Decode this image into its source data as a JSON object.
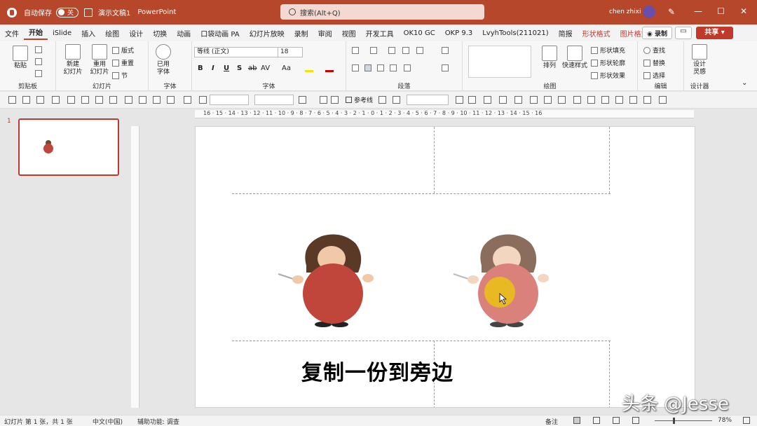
{
  "titlebar": {
    "autosave_label": "自动保存",
    "autosave_state": "关",
    "doc_title": "演示文稿1",
    "app_name": "PowerPoint",
    "search_placeholder": "搜索(Alt+Q)",
    "user_name": "chen zhixi",
    "minimize": "—",
    "restore": "☐",
    "close": "✕"
  },
  "tabs": [
    "文件",
    "开始",
    "iSlide",
    "插入",
    "绘图",
    "设计",
    "切换",
    "动画",
    "口袋动画 PA",
    "幻灯片放映",
    "录制",
    "审阅",
    "视图",
    "开发工具",
    "OK10 GC",
    "OKP 9.3",
    "LvyhTools(211021)",
    "简报",
    "形状格式",
    "图片格式"
  ],
  "active_tab": "开始",
  "actions": {
    "record": "◉ 录制",
    "comment": "▭",
    "share": "共享 ▾"
  },
  "ribbon": {
    "clipboard": {
      "paste": "粘贴",
      "label": "剪贴板"
    },
    "slides": {
      "new_slide": "新建\n幻灯片",
      "reuse": "重用\n幻灯片",
      "layout": "版式",
      "reset": "重置",
      "section": "节",
      "label": "幻灯片"
    },
    "font_ext": {
      "use_font": "已用字体",
      "label": "字体"
    },
    "font": {
      "name": "等线 (正文)",
      "size": "18",
      "bold": "B",
      "italic": "I",
      "underline": "U",
      "strike": "S",
      "shadow": "ab",
      "spacing": "AV",
      "case": "Aa",
      "label": "字体"
    },
    "paragraph": {
      "label": "段落"
    },
    "drawing": {
      "arrange": "排列",
      "quick_style": "快速样式",
      "fill": "形状填充",
      "outline": "形状轮廓",
      "effects": "形状效果",
      "label": "绘图"
    },
    "editing": {
      "find": "查找",
      "replace": "替换",
      "select": "选择",
      "label": "编辑"
    },
    "designer": {
      "ideas": "设计\n灵感",
      "label": "设计器"
    }
  },
  "toolbar2": {
    "refline": "参考线"
  },
  "thumbs": {
    "slide_num": "1"
  },
  "ruler": {
    "top_ticks": "16 · 15 · 14 · 13 · 12 · 11 · 10 · 9 · 8 · 7 · 6 · 5 · 4 · 3 · 2 · 1 · 0 · 1 · 2 · 3 · 4 · 5 · 6 · 7 · 8 · 9 · 10 · 11 · 12 · 13 · 14 · 15 · 16"
  },
  "caption": "复制一份到旁边",
  "watermark": "头条 @Jesse",
  "statusbar": {
    "slide_info": "幻灯片 第 1 张，共 1 张",
    "language": "中文(中国)",
    "accessibility": "辅助功能: 调查",
    "notes": "备注",
    "zoom": "78%"
  },
  "colors": {
    "accent": "#b7472a",
    "circle_red": "#c0453a",
    "circle_faded": "#d9817a",
    "circle_yellow": "#e8b923"
  }
}
